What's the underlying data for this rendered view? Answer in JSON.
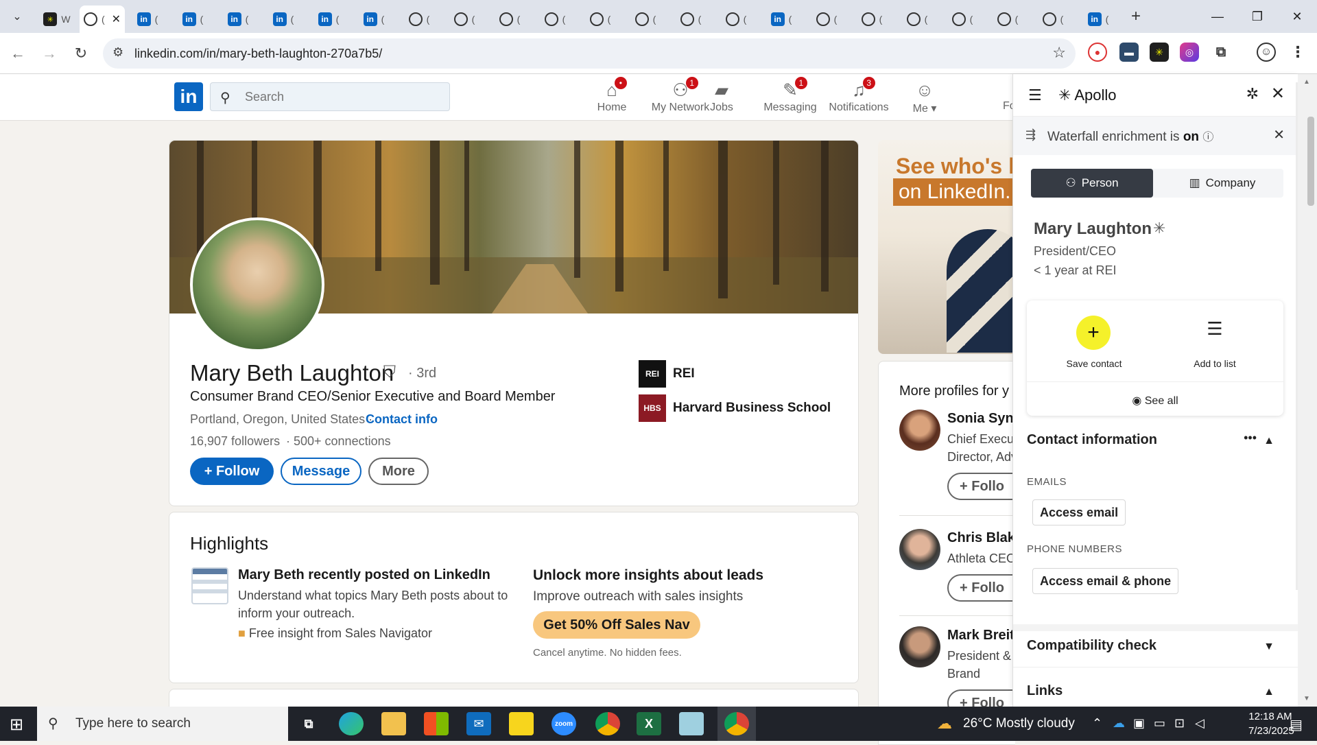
{
  "browser": {
    "tabs": [
      {
        "icon": "apollo",
        "label": "W",
        "active": false
      },
      {
        "icon": "ring",
        "label": "(",
        "active": true
      },
      {
        "icon": "linkedin",
        "label": "(",
        "active": false
      },
      {
        "icon": "linkedin",
        "label": "(",
        "active": false
      },
      {
        "icon": "linkedin",
        "label": "(",
        "active": false
      },
      {
        "icon": "linkedin",
        "label": "(",
        "active": false
      },
      {
        "icon": "linkedin",
        "label": "(",
        "active": false
      },
      {
        "icon": "linkedin",
        "label": "(",
        "active": false
      },
      {
        "icon": "ring",
        "label": "(",
        "active": false
      },
      {
        "icon": "ring",
        "label": "(",
        "active": false
      },
      {
        "icon": "ring",
        "label": "(",
        "active": false
      },
      {
        "icon": "ring",
        "label": "(",
        "active": false
      },
      {
        "icon": "ring",
        "label": "(",
        "active": false
      },
      {
        "icon": "ring",
        "label": "(",
        "active": false
      },
      {
        "icon": "ring",
        "label": "(",
        "active": false
      },
      {
        "icon": "ring",
        "label": "(",
        "active": false
      },
      {
        "icon": "linkedin",
        "label": "(",
        "active": false
      },
      {
        "icon": "ring",
        "label": "(",
        "active": false
      },
      {
        "icon": "ring",
        "label": "(",
        "active": false
      },
      {
        "icon": "ring",
        "label": "(",
        "active": false
      },
      {
        "icon": "ring",
        "label": "(",
        "active": false
      },
      {
        "icon": "ring",
        "label": "(",
        "active": false
      },
      {
        "icon": "ring",
        "label": "(",
        "active": false
      },
      {
        "icon": "linkedin",
        "label": "(",
        "active": false
      }
    ],
    "close_tab_glyph": "✕",
    "new_tab_glyph": "+",
    "url": "linkedin.com/in/mary-beth-laughton-270a7b5/"
  },
  "linkedin": {
    "search_placeholder": "Search",
    "nav": [
      {
        "name": "home",
        "label": "Home",
        "badge": "•"
      },
      {
        "name": "my-network",
        "label": "My Network",
        "badge": "1"
      },
      {
        "name": "jobs",
        "label": "Jobs",
        "badge": ""
      },
      {
        "name": "messaging",
        "label": "Messaging",
        "badge": "1"
      },
      {
        "name": "notifications",
        "label": "Notifications",
        "badge": "3"
      },
      {
        "name": "me",
        "label": "Me ▾",
        "badge": ""
      }
    ],
    "nav_overflow": "Fo",
    "profile": {
      "name": "Mary Beth Laughton",
      "degree": "· 3rd",
      "headline": "Consumer Brand CEO/Senior Executive and Board Member",
      "location": "Portland, Oregon, United States ·",
      "contact_info": "Contact info",
      "followers": "16,907 followers",
      "connections": "· 500+ connections",
      "buttons": {
        "follow": "+ Follow",
        "message": "Message",
        "more": "More"
      },
      "orgs": [
        {
          "logo_text": "REI",
          "name": "REI"
        },
        {
          "logo_text": "HBS",
          "name": "Harvard Business School"
        }
      ]
    },
    "highlights": {
      "title": "Highlights",
      "post_heading": "Mary Beth recently posted on LinkedIn",
      "post_desc": "Understand what topics Mary Beth posts about to inform your outreach.",
      "free_insight": "Free insight from Sales Navigator",
      "unlock_heading": "Unlock more insights about leads",
      "unlock_sub": "Improve outreach with sales insights",
      "cta": "Get 50% Off Sales Nav",
      "fine_print": "Cancel anytime. No hidden fees."
    },
    "ad": {
      "line1": "See who's hiri",
      "line2": "on LinkedIn."
    },
    "more_profiles": {
      "title": "More profiles for y",
      "items": [
        {
          "name": "Sonia Syng",
          "role": "Chief Execut",
          "role2": "Director, Adv",
          "follow": "+ Follo"
        },
        {
          "name": "Chris Blake",
          "role": "Athleta CEO",
          "role2": "",
          "follow": "+ Follo"
        },
        {
          "name": "Mark Breit",
          "role": "President &",
          "role2": "Brand",
          "follow": "+ Follo"
        }
      ]
    }
  },
  "apollo": {
    "logo": "✳ Apollo",
    "waterfall_prefix": "Waterfall enrichment is ",
    "waterfall_state": "on",
    "tab_person": "Person",
    "tab_company": "Company",
    "name": "Mary Laughton",
    "title": "President/CEO",
    "tenure": "< 1 year at REI",
    "save_contact": "Save contact",
    "add_to_list": "Add to list",
    "see_all": "See all",
    "contact_information": "Contact information",
    "emails_label": "EMAILS",
    "access_email": "Access email",
    "phone_label": "PHONE NUMBERS",
    "access_email_phone": "Access email & phone",
    "compatibility": "Compatibility check",
    "links": "Links"
  },
  "taskbar": {
    "search_placeholder": "Type here to search",
    "weather": "26°C  Mostly cloudy",
    "time": "12:18 AM",
    "date": "7/23/2025"
  },
  "colors": {
    "linkedin_blue": "#0a66c2",
    "apollo_yellow": "#f5f12a",
    "badge_red": "#cc1016",
    "sales_nav_gold": "#f8c77e"
  }
}
